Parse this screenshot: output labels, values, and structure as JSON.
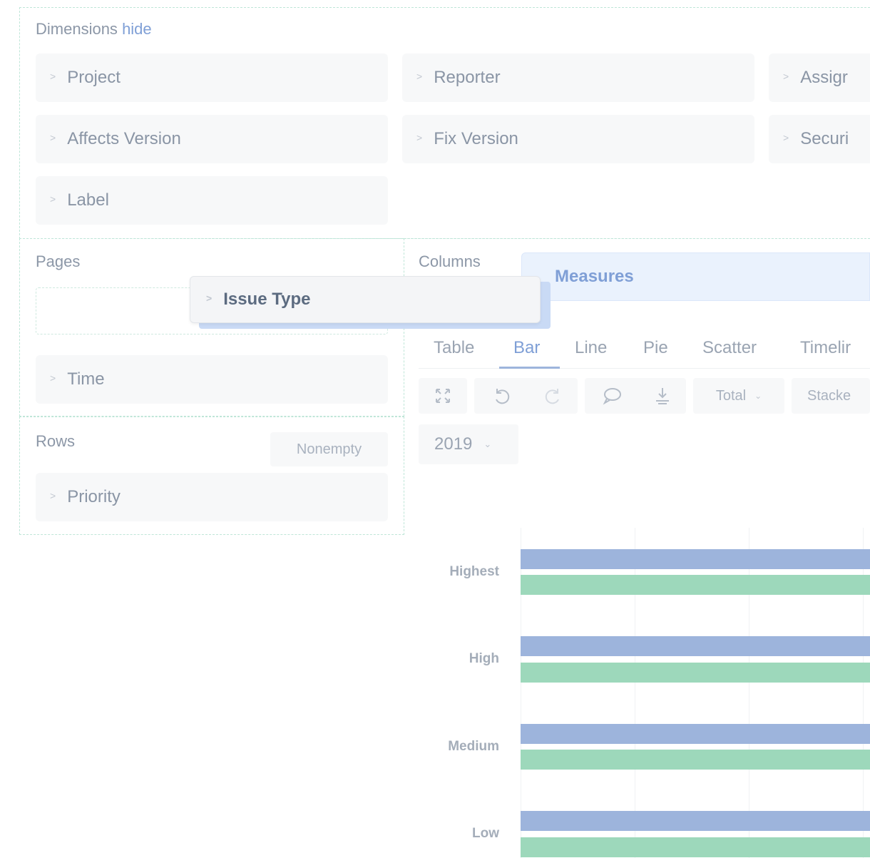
{
  "dimensions": {
    "label": "Dimensions",
    "hide_link": "hide",
    "items": [
      "Project",
      "Reporter",
      "Assigr",
      "Affects Version",
      "Fix Version",
      "Securi",
      "Label"
    ]
  },
  "pages": {
    "label": "Pages",
    "items": [
      "Time"
    ]
  },
  "drag": {
    "label": "Issue Type"
  },
  "rows": {
    "label": "Rows",
    "nonempty_label": "Nonempty",
    "items": [
      "Priority"
    ]
  },
  "columns": {
    "label": "Columns",
    "items": [
      "Measures"
    ]
  },
  "chart_tabs": [
    "Table",
    "Bar",
    "Line",
    "Pie",
    "Scatter",
    "Timelir"
  ],
  "active_tab": "Bar",
  "toolbar": {
    "icons": [
      "fullscreen-icon",
      "undo-icon",
      "redo-icon",
      "comment-icon",
      "download-icon"
    ],
    "total_label": "Total",
    "stacked_label": "Stacke"
  },
  "year_select": {
    "value": "2019"
  },
  "colors": {
    "series1": "#9db4dc",
    "series2": "#9dd8bb",
    "accent": "#7f9fd6"
  },
  "chart_data": {
    "type": "bar",
    "orientation": "horizontal",
    "categories": [
      "Highest",
      "High",
      "Medium",
      "Low"
    ],
    "series": [
      {
        "values": [
          null,
          null,
          null,
          null
        ]
      },
      {
        "values": [
          null,
          null,
          null,
          null
        ]
      }
    ]
  }
}
